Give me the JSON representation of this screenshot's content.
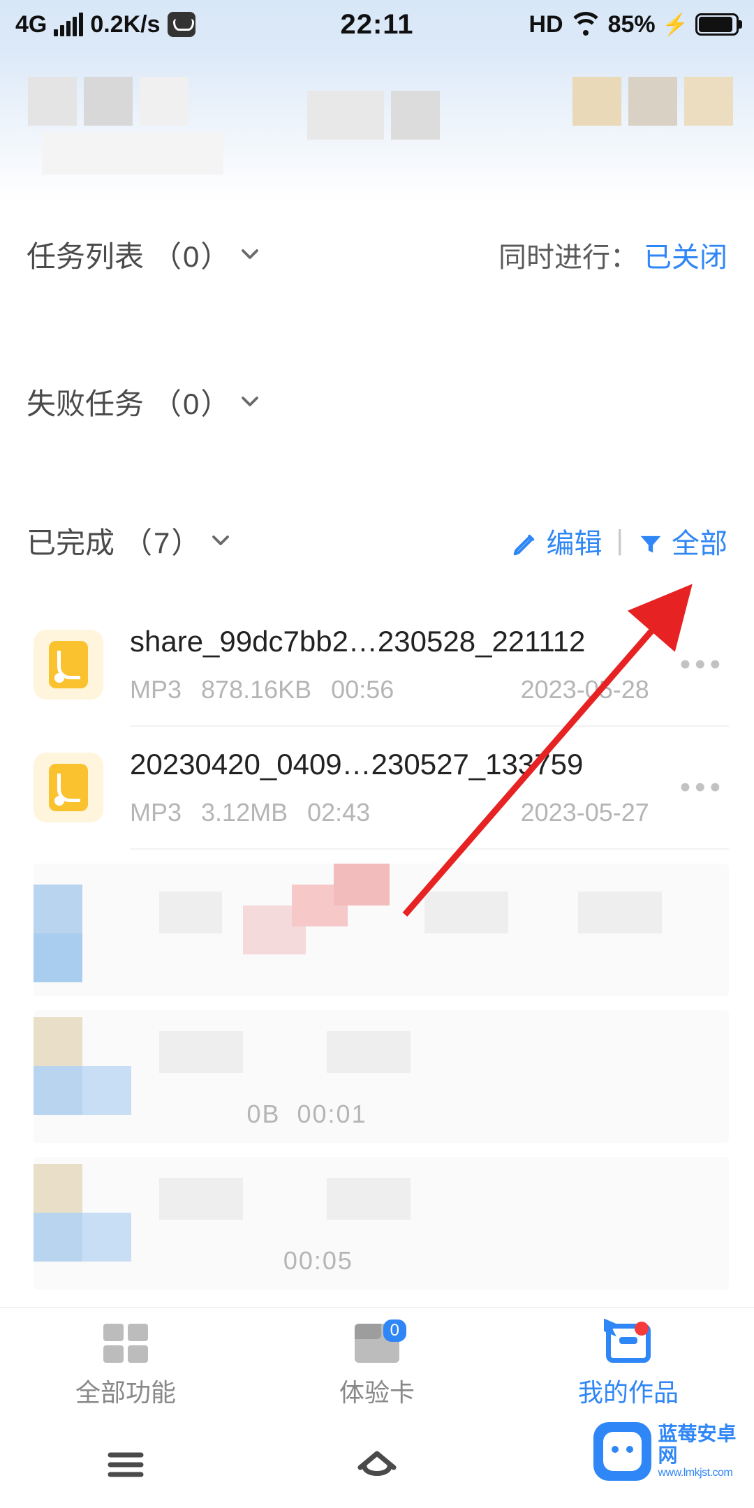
{
  "status": {
    "net_type": "4G",
    "speed": "0.2K/s",
    "time": "22:11",
    "hd": "HD",
    "battery_pct": "85%"
  },
  "sections": {
    "task_list": {
      "label": "任务列表",
      "count": "（0）"
    },
    "failed": {
      "label": "失败任务",
      "count": "（0）"
    },
    "completed": {
      "label": "已完成",
      "count": "（7）"
    }
  },
  "concurrent": {
    "label": "同时进行：",
    "state": "已关闭"
  },
  "done_actions": {
    "edit": "编辑",
    "filter": "全部"
  },
  "files": [
    {
      "name": "share_99dc7bb2…230528_221112",
      "format": "MP3",
      "size": "878.16KB",
      "duration": "00:56",
      "date": "2023-05-28"
    },
    {
      "name": "20230420_0409…230527_133759",
      "format": "MP3",
      "size": "3.12MB",
      "duration": "02:43",
      "date": "2023-05-27"
    }
  ],
  "pix_hints": [
    "",
    "00:01",
    "00:05"
  ],
  "tabs": {
    "all": {
      "label": "全部功能"
    },
    "card": {
      "label": "体验卡",
      "badge": "0"
    },
    "mine": {
      "label": "我的作品"
    }
  },
  "watermark": {
    "title": "蓝莓安卓网",
    "sub": "www.lmkjst.com"
  }
}
